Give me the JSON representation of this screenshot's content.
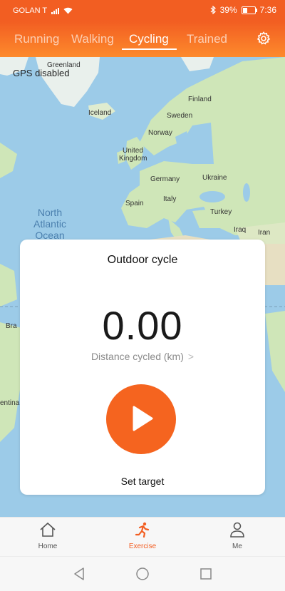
{
  "status": {
    "carrier": "GOLAN T",
    "battery_percent": "39%",
    "battery_level": 0.39,
    "time": "7:36"
  },
  "tabs": [
    {
      "label": "Running",
      "active": false
    },
    {
      "label": "Walking",
      "active": false
    },
    {
      "label": "Cycling",
      "active": true
    },
    {
      "label": "Trained",
      "active": false
    }
  ],
  "map": {
    "gps_status": "GPS disabled",
    "labels": {
      "greenland": "Greenland",
      "iceland": "Iceland",
      "finland": "Finland",
      "sweden": "Sweden",
      "norway": "Norway",
      "united_kingdom_1": "United",
      "united_kingdom_2": "Kingdom",
      "germany": "Germany",
      "ukraine": "Ukraine",
      "spain": "Spain",
      "italy": "Italy",
      "turkey": "Turkey",
      "iraq": "Iraq",
      "iran": "Iran",
      "brazil_partial": "Bra",
      "argentina_partial": "entina",
      "ocean_1": "North",
      "ocean_2": "Atlantic",
      "ocean_3": "Ocean"
    }
  },
  "workout": {
    "title": "Outdoor cycle",
    "distance_value": "0.00",
    "distance_label": "Distance cycled (km)",
    "set_target": "Set target"
  },
  "bottom_nav": [
    {
      "label": "Home",
      "icon": "home-icon",
      "active": false
    },
    {
      "label": "Exercise",
      "icon": "running-person-icon",
      "active": true
    },
    {
      "label": "Me",
      "icon": "person-icon",
      "active": false
    }
  ],
  "colors": {
    "accent": "#f25e22",
    "start_button": "#f5641f",
    "ocean": "#9ccbe8",
    "land": "#cfe6b8"
  }
}
